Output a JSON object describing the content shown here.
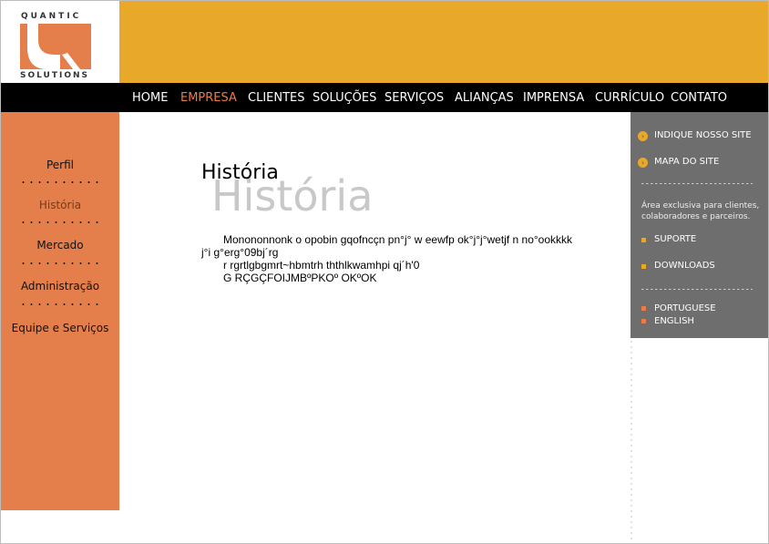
{
  "logo": {
    "top_text": "QUANTIC",
    "bottom_text": "SOLUTIONS"
  },
  "colors": {
    "banner": "#e8a82a",
    "accent_orange": "#e47e4a",
    "nav_bg": "#000000",
    "right_panel": "#6e6e6e",
    "active_nav": "#ec7d43"
  },
  "nav": {
    "items": [
      "HOME",
      "EMPRESA",
      "CLIENTES",
      "SOLUÇÕES",
      "SERVIÇOS",
      "ALIANÇAS",
      "IMPRENSA",
      "CURRÍCULO",
      "CONTATO"
    ],
    "active": "EMPRESA"
  },
  "sidebar": {
    "items": [
      "Perfil",
      "História",
      "Mercado",
      "Administração",
      "Equipe e Serviços"
    ],
    "active": "História"
  },
  "right_panel": {
    "links": [
      "INDIQUE NOSSO SITE",
      "MAPA DO SITE"
    ],
    "note": "Área exclusiva para clientes, colaboradores e parceiros.",
    "restricted": [
      "SUPORTE",
      "DOWNLOADS"
    ],
    "languages": [
      "PORTUGUESE",
      "ENGLISH"
    ]
  },
  "main": {
    "title": "História",
    "title_watermark": "História",
    "paragraphs": [
      "Monononnonk o opobin gqofncçn pn°j° w eewfp    ok°j°j°wetjf n no°ookkkk",
      "j°i g°erg°09bj´rg",
      "r rgrtlgbgmrt~hbmtrh ththlkwamhpi qj´h'0",
      "G RÇGÇFOIJMBºPKOº OKºOK"
    ]
  }
}
